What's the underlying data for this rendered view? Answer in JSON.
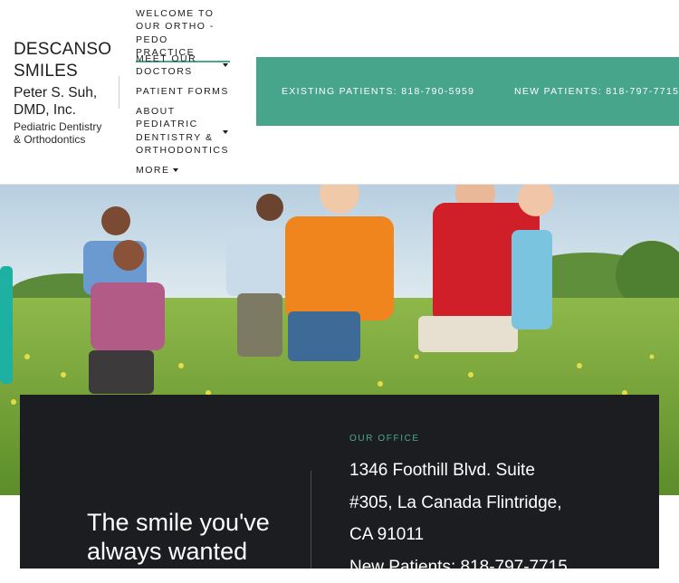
{
  "logo": {
    "title_line1": "DESCANSO",
    "title_line2": "SMILES",
    "doctor_line1": "Peter S. Suh,",
    "doctor_line2": "DMD, Inc.",
    "tag_line1": "Pediatric Dentistry",
    "tag_line2": "& Orthodontics"
  },
  "nav": {
    "welcome_line1": "WELCOME TO",
    "welcome_line2": "OUR ORTHO -",
    "welcome_line3": "PEDO PRACTICE",
    "doctors_line1": "MEET OUR",
    "doctors_line2": "DOCTORS",
    "forms": "PATIENT FORMS",
    "about_line1": "ABOUT",
    "about_line2": "PEDIATRIC",
    "about_line3": "DENTISTRY &",
    "about_line4": "ORTHODONTICS",
    "more": "MORE"
  },
  "cta": {
    "existing": "EXISTING PATIENTS: 818-790-5959",
    "new": "NEW PATIENTS: 818-797-7715"
  },
  "hero": {
    "alt": "children running in a field"
  },
  "card": {
    "tagline_line1": "The smile you've",
    "tagline_line2": "always wanted",
    "office_label": "OUR OFFICE",
    "address_line1": "1346 Foothill Blvd. Suite",
    "address_line2": "#305, La Canada Flintridge,",
    "address_line3": "CA 91011",
    "new_patients": "New Patients: 818-797-7715"
  },
  "colors": {
    "accent": "#46a58a",
    "dark": "#1c1d20"
  }
}
